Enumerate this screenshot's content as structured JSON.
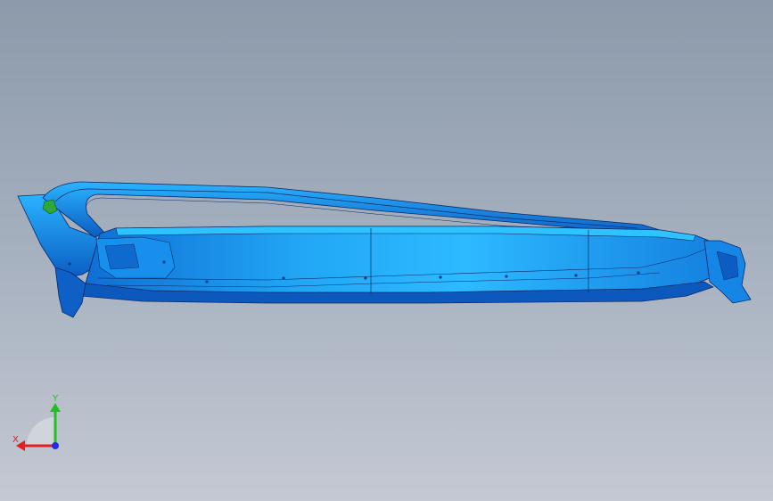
{
  "viewport": {
    "background_top": "#8c9aab",
    "background_bottom": "#c4c9d3"
  },
  "model": {
    "shape": "cad-sheet-metal-part",
    "body_color": "#1a8fe8",
    "highlight_color": "#28b6ff",
    "shadow_color": "#0a4aa8",
    "edge_color": "#0b2a66",
    "accent_color": "#2fa83a"
  },
  "triad": {
    "x_label": "X",
    "y_label": "Y",
    "x_color": "#e02020",
    "y_color": "#20c020",
    "z_color": "#2030e0"
  }
}
